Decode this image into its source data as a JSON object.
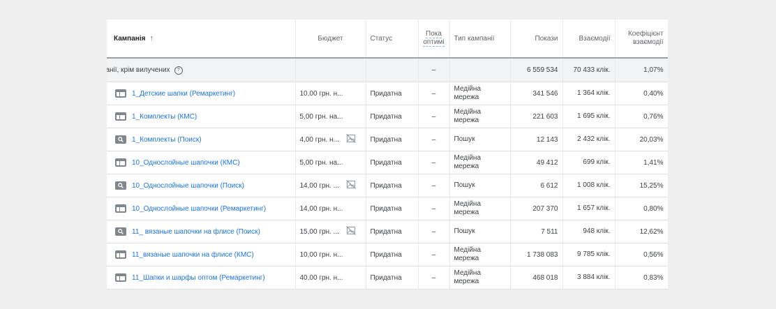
{
  "headers": {
    "campaign": "Кампанія",
    "sort_arrow": "↑",
    "budget": "Бюджет",
    "status": "Статус",
    "optimization": "Пока оптимі",
    "type": "Тип кампанії",
    "impressions": "Покази",
    "interactions": "Взаємодії",
    "interaction_rate": "Коефіцієнт взаємодії"
  },
  "total": {
    "label": "кампанії, крім вилучених",
    "help": "?",
    "optimization": "–",
    "impressions": "6 559 534",
    "interactions": "70 433 клік.",
    "rate": "1,07%"
  },
  "rows": [
    {
      "icon": "display",
      "name": "1_Детские шапки (Ремаркетинг)",
      "budget": "10,00 грн. н...",
      "noimg": false,
      "status": "Придатна",
      "opt": "–",
      "type": "Медійна мережа",
      "impr": "341 546",
      "inter": "1 364 клік.",
      "rate": "0,40%"
    },
    {
      "icon": "display",
      "name": "1_Комплекты (КМС)",
      "budget": "5,00 грн. на...",
      "noimg": false,
      "status": "Придатна",
      "opt": "–",
      "type": "Медійна мережа",
      "impr": "221 603",
      "inter": "1 695 клік.",
      "rate": "0,76%"
    },
    {
      "icon": "search",
      "name": "1_Комплекты (Поиск)",
      "budget": "4,00 грн. н...",
      "noimg": true,
      "status": "Придатна",
      "opt": "–",
      "type": "Пошук",
      "impr": "12 143",
      "inter": "2 432 клік.",
      "rate": "20,03%"
    },
    {
      "icon": "display",
      "name": "10_Однослойные шапочки (КМС)",
      "budget": "5,00 грн. на...",
      "noimg": false,
      "status": "Придатна",
      "opt": "–",
      "type": "Медійна мережа",
      "impr": "49 412",
      "inter": "699 клік.",
      "rate": "1,41%"
    },
    {
      "icon": "search",
      "name": "10_Однослойные шапочки (Поиск)",
      "budget": "14,00 грн. ...",
      "noimg": true,
      "status": "Придатна",
      "opt": "–",
      "type": "Пошук",
      "impr": "6 612",
      "inter": "1 008 клік.",
      "rate": "15,25%"
    },
    {
      "icon": "display",
      "name": "10_Однослойные шапочки (Ремаркетинг)",
      "budget": "14,00 грн. н...",
      "noimg": false,
      "status": "Придатна",
      "opt": "–",
      "type": "Медійна мережа",
      "impr": "207 370",
      "inter": "1 657 клік.",
      "rate": "0,80%"
    },
    {
      "icon": "search",
      "name": "11_ вязаные шапочки на флисе (Поиск)",
      "budget": "15,00 грн. ...",
      "noimg": true,
      "status": "Придатна",
      "opt": "–",
      "type": "Пошук",
      "impr": "7 511",
      "inter": "948 клік.",
      "rate": "12,62%"
    },
    {
      "icon": "display",
      "name": "11_вязаные шапочки на флисе (КМС)",
      "budget": "10,00 грн. н...",
      "noimg": false,
      "status": "Придатна",
      "opt": "–",
      "type": "Медійна мережа",
      "impr": "1 738 083",
      "inter": "9 785 клік.",
      "rate": "0,56%"
    },
    {
      "icon": "display",
      "name": "11_Шапки и шарфы оптом (Ремаркетинг)",
      "budget": "40,00 грн. н...",
      "noimg": false,
      "status": "Придатна",
      "opt": "–",
      "type": "Медійна мережа",
      "impr": "468 018",
      "inter": "3 884 клік.",
      "rate": "0,83%"
    }
  ]
}
